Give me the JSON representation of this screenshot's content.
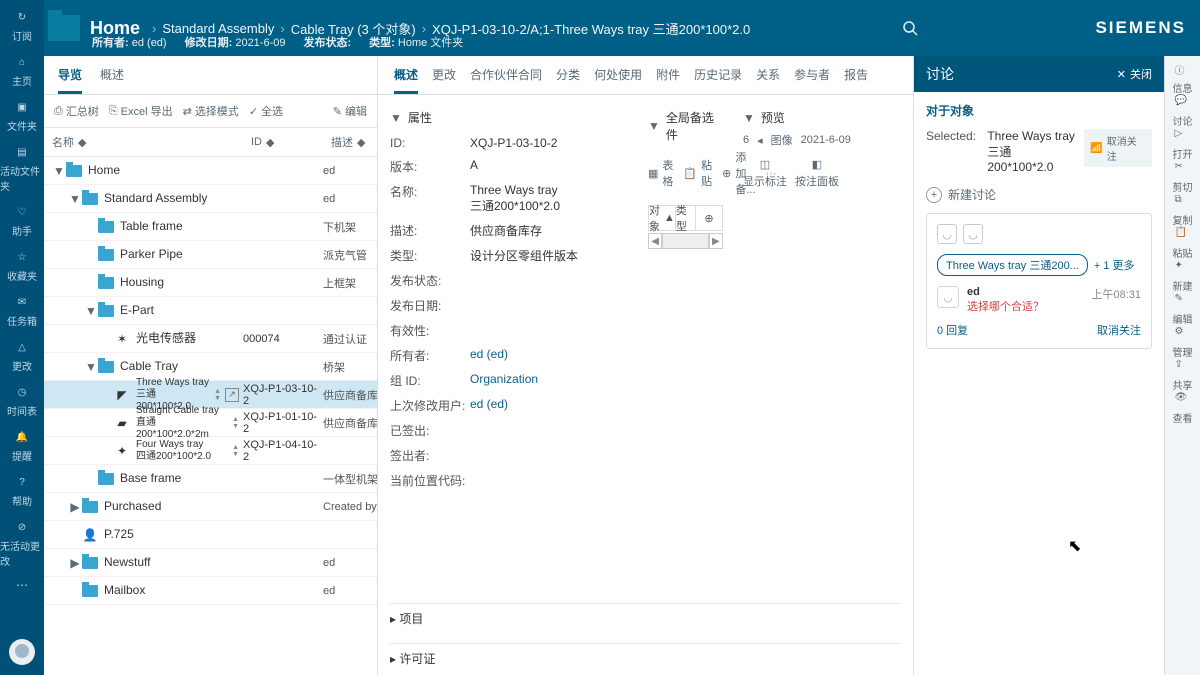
{
  "header": {
    "title": "Home",
    "crumbs": [
      "Standard Assembly",
      "Cable Tray (3 个对象)",
      "XQJ-P1-03-10-2/A;1-Three Ways tray 三通200*100*2.0"
    ],
    "owner_k": "所有者:",
    "owner_v": "ed (ed)",
    "mod_k": "修改日期:",
    "mod_v": "2021-6-09",
    "pub_k": "发布状态:",
    "type_k": "类型:",
    "type_v": "Home 文件夹",
    "brand": "SIEMENS"
  },
  "leftnav": [
    "订阅",
    "主页",
    "文件夹",
    "活动文件夹",
    "助手",
    "收藏夹",
    "任务箱",
    "更改",
    "时间表",
    "提醒",
    "帮助",
    "无活动更改"
  ],
  "rightnav": [
    "信息",
    "讨论",
    "打开",
    "剪切",
    "复制",
    "粘贴",
    "新建",
    "编辑",
    "管理",
    "共享",
    "查看"
  ],
  "treeTabs": {
    "nav": "导览",
    "overview": "概述"
  },
  "treeToolbar": {
    "sum": "汇总树",
    "excel": "Excel 导出",
    "mode": "选择模式",
    "all": "全选",
    "edit": "编辑"
  },
  "treeCols": {
    "name": "名称",
    "id": "ID",
    "desc": "描述"
  },
  "tree": [
    {
      "d": 0,
      "tw": "▼",
      "folder": true,
      "lbl": "Home",
      "id": "",
      "desc": "ed"
    },
    {
      "d": 1,
      "tw": "▼",
      "folder": true,
      "lbl": "Standard Assembly",
      "id": "",
      "desc": "ed"
    },
    {
      "d": 2,
      "tw": "",
      "folder": true,
      "lbl": "Table frame",
      "id": "",
      "desc": "下机架"
    },
    {
      "d": 2,
      "tw": "",
      "folder": true,
      "lbl": "Parker Pipe",
      "id": "",
      "desc": "派克气管"
    },
    {
      "d": 2,
      "tw": "",
      "folder": true,
      "lbl": "Housing",
      "id": "",
      "desc": "上框架"
    },
    {
      "d": 2,
      "tw": "▼",
      "folder": true,
      "lbl": "E-Part",
      "id": "",
      "desc": ""
    },
    {
      "d": 3,
      "tw": "",
      "item": "sensor",
      "lbl": "光电传感器",
      "id": "000074",
      "desc": "通过认证"
    },
    {
      "d": 2,
      "tw": "▼",
      "folder": true,
      "lbl": "Cable Tray",
      "id": "",
      "desc": "桥架"
    },
    {
      "d": 3,
      "tw": "",
      "item": "tray3",
      "two": true,
      "sel": true,
      "lbl": "Three Ways tray\n三通200*100*2.0",
      "id": "XQJ-P1-03-10-2",
      "desc": "供应商备库",
      "arrows": true,
      "ext": true
    },
    {
      "d": 3,
      "tw": "",
      "item": "tray1",
      "two": true,
      "lbl": "Straight Cable tray\n直通200*100*2.0*2m",
      "id": "XQJ-P1-01-10-2",
      "desc": "供应商备库",
      "arrows": true
    },
    {
      "d": 3,
      "tw": "",
      "item": "tray4",
      "two": true,
      "lbl": "Four Ways tray\n四通200*100*2.0",
      "id": "XQJ-P1-04-10-2",
      "desc": "",
      "arrows": true
    },
    {
      "d": 2,
      "tw": "",
      "folder": true,
      "lbl": "Base frame",
      "id": "",
      "desc": "一体型机架"
    },
    {
      "d": 1,
      "tw": "▶",
      "folder": true,
      "lbl": "Purchased",
      "id": "",
      "desc": "Created by"
    },
    {
      "d": 1,
      "tw": "",
      "item": "person",
      "lbl": "P.725",
      "id": "",
      "desc": ""
    },
    {
      "d": 1,
      "tw": "▶",
      "folder": true,
      "lbl": "Newstuff",
      "id": "",
      "desc": "ed"
    },
    {
      "d": 1,
      "tw": "",
      "folder": true,
      "lbl": "Mailbox",
      "id": "",
      "desc": "ed"
    }
  ],
  "detailTabs": [
    "概述",
    "更改",
    "合作伙伴合同",
    "分类",
    "何处使用",
    "附件",
    "历史记录",
    "关系",
    "参与者",
    "报告"
  ],
  "props": {
    "title": "属性",
    "rows": [
      {
        "k": "ID:",
        "v": "XQJ-P1-03-10-2"
      },
      {
        "k": "版本:",
        "v": "A"
      },
      {
        "k": "名称:",
        "v": "Three Ways tray\n三通200*100*2.0"
      },
      {
        "k": "描述:",
        "v": "供应商备库存"
      },
      {
        "k": "类型:",
        "v": "设计分区零组件版本"
      },
      {
        "k": "发布状态:",
        "v": ""
      },
      {
        "k": "发布日期:",
        "v": ""
      },
      {
        "k": "有效性:",
        "v": ""
      },
      {
        "k": "所有者:",
        "v": "ed (ed)",
        "link": true
      },
      {
        "k": "组 ID:",
        "v": "Organization",
        "link": true
      },
      {
        "k": "上次修改用户:",
        "v": "ed (ed)",
        "link": true
      },
      {
        "k": "已签出:",
        "v": ""
      },
      {
        "k": "签出者:",
        "v": ""
      },
      {
        "k": "当前位置代码:",
        "v": ""
      }
    ],
    "sub1": "项目",
    "sub2": "许可证"
  },
  "mid": {
    "title": "全局备选件",
    "btns": {
      "table": "表格",
      "paste": "粘贴",
      "add": "添加备..."
    },
    "col1": "对象",
    "col2": "类型"
  },
  "preview": {
    "title": "预览",
    "count": "6",
    "type": "图像",
    "date": "2021-6-09",
    "show": "显示标注",
    "pin": "按注面板"
  },
  "disc": {
    "title": "讨论",
    "close": "关闭",
    "sub": "对于对象",
    "sel_k": "Selected:",
    "sel_v": "Three Ways tray\n三通200*100*2.0",
    "cancel": "取消关注",
    "new": "新建讨论",
    "chip": "Three Ways tray 三通200...",
    "more": "+ 1 更多",
    "msg": {
      "name": "ed",
      "text": "选择哪个合适？",
      "time": "上午08:31"
    },
    "reply": "0 回复",
    "unfollow": "取消关注"
  }
}
